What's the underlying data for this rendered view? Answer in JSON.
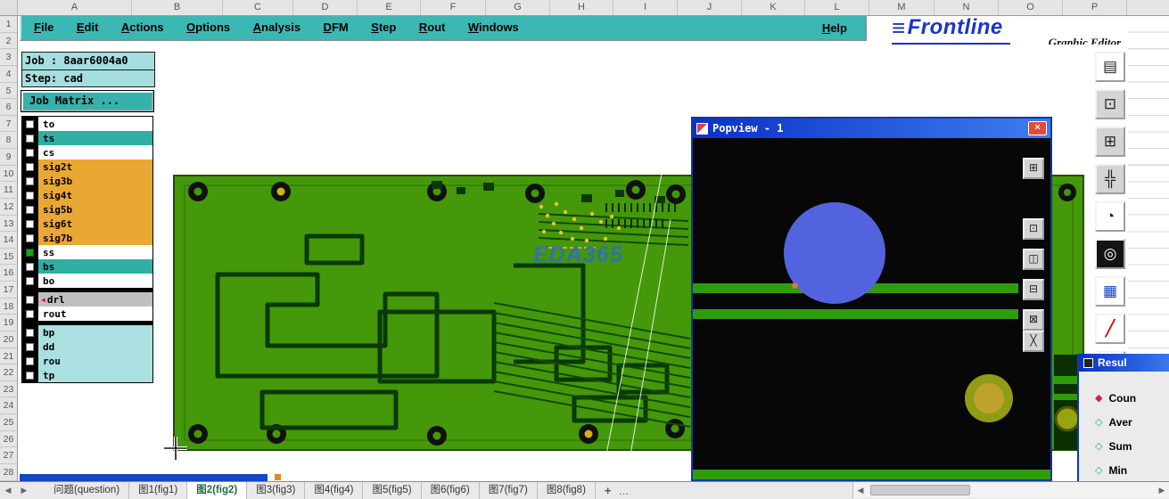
{
  "excel": {
    "columns": [
      {
        "label": "A",
        "css": "width:128px"
      },
      {
        "label": "B",
        "css": "width:102px"
      },
      {
        "label": "C",
        "css": "width:79px"
      },
      {
        "label": "D",
        "css": "width:72px"
      },
      {
        "label": "E",
        "css": "width:71px"
      },
      {
        "label": "F",
        "css": "width:73px"
      },
      {
        "label": "G",
        "css": "width:72px"
      },
      {
        "label": "H",
        "css": "width:71px"
      },
      {
        "label": "I",
        "css": "width:72px"
      },
      {
        "label": "J",
        "css": "width:72px"
      },
      {
        "label": "K",
        "css": "width:71px"
      },
      {
        "label": "L",
        "css": "width:72px"
      },
      {
        "label": "M",
        "css": "width:73px"
      },
      {
        "label": "N",
        "css": "width:72px"
      },
      {
        "label": "O",
        "css": "width:72px"
      },
      {
        "label": "P",
        "css": "width:72px"
      }
    ],
    "rows": [
      "1",
      "2",
      "3",
      "4",
      "5",
      "6",
      "7",
      "8",
      "9",
      "10",
      "11",
      "12",
      "13",
      "14",
      "15",
      "16",
      "17",
      "18",
      "19",
      "20",
      "21",
      "22",
      "23",
      "24",
      "25",
      "26",
      "27",
      "28"
    ],
    "nav_prev": "◀",
    "nav_next": "▶",
    "sheet_tabs": [
      {
        "label": "问题(question)",
        "css": ""
      },
      {
        "label": "图1(fig1)",
        "css": ""
      },
      {
        "label": "图2(fig2)",
        "css": "background:#ffffff;color:#1e6e41;font-weight:bold"
      },
      {
        "label": "图3(fig3)",
        "css": ""
      },
      {
        "label": "图4(fig4)",
        "css": ""
      },
      {
        "label": "图5(fig5)",
        "css": ""
      },
      {
        "label": "图6(fig6)",
        "css": ""
      },
      {
        "label": "图7(fig7)",
        "css": ""
      },
      {
        "label": "图8(fig8)",
        "css": ""
      }
    ],
    "add_sheet": "+",
    "tab_overflow": "…",
    "scroll_left": "◀",
    "scroll_right": "▶"
  },
  "app": {
    "menu": [
      "File",
      "Edit",
      "Actions",
      "Options",
      "Analysis",
      "DFM",
      "Step",
      "Rout",
      "Windows"
    ],
    "help": "Help",
    "logo": {
      "mark": "≡",
      "brand": "Frontline",
      "subtitle": "Graphic Editor"
    },
    "job_label": "Job : 8aar6004a0",
    "step_label": "Step: cad",
    "matrix_button": "Job Matrix ...",
    "watermark": "EDA365",
    "layers_top": [
      {
        "name": "to",
        "css": "background:#ffffff"
      },
      {
        "name": "ts",
        "css": "background:#2faea4"
      },
      {
        "name": "cs",
        "css": "background:#ffffff"
      },
      {
        "name": "sig2t",
        "css": "background:#e9a733"
      },
      {
        "name": "sig3b",
        "css": "background:#e9a733"
      },
      {
        "name": "sig4t",
        "css": "background:#e9a733"
      },
      {
        "name": "sig5b",
        "css": "background:#e9a733"
      },
      {
        "name": "sig6t",
        "css": "background:#e9a733"
      },
      {
        "name": "sig7b",
        "css": "background:#e9a733"
      },
      {
        "name": "ss",
        "css": "background:#ffffff",
        "box_css": "background:#1ca01c;border-color:#0a600a"
      },
      {
        "name": "bs",
        "css": "background:#2faea4"
      },
      {
        "name": "bo",
        "css": "background:#ffffff"
      }
    ],
    "layers_mid": [
      {
        "name": "drl",
        "css": "background:#bfbfbf",
        "mark": "◀",
        "mark_css": "color:#d42020"
      },
      {
        "name": "rout",
        "css": "background:#ffffff"
      }
    ],
    "layers_bot": [
      {
        "name": "bp",
        "css": "background:#abe0e0"
      },
      {
        "name": "dd",
        "css": "background:#abe0e0"
      },
      {
        "name": "rou",
        "css": "background:#abe0e0"
      },
      {
        "name": "tp",
        "css": "background:#abe0e0"
      }
    ],
    "toolbar": [
      {
        "name": "tool-page-button",
        "glyph": "▤",
        "css": "background:#ffffff"
      },
      {
        "name": "tool-export-window-button",
        "glyph": "⊡",
        "css": ""
      },
      {
        "name": "tool-tile-window-button",
        "glyph": "⊞",
        "css": ""
      },
      {
        "name": "tool-pan-crosshair-button",
        "glyph": "╬",
        "css": ""
      },
      {
        "name": "tool-gauge-button",
        "glyph": "◔",
        "css": "background:#ffffff"
      },
      {
        "name": "tool-target-button",
        "glyph": "◎",
        "css": "background:#141414;color:#ffffff"
      },
      {
        "name": "tool-palette-button",
        "glyph": "▦",
        "css": "background:#ffffff;color:#1040d0"
      },
      {
        "name": "tool-measure-line-button",
        "glyph": "╱",
        "css": "background:#ffffff;color:#d01818;font-weight:bold"
      },
      {
        "name": "tool-snippet-button",
        "glyph": "⊡",
        "css": "background:#ffffff;color:#d01818"
      }
    ],
    "popview": {
      "title": "Popview - 1",
      "close": "×",
      "tools": [
        {
          "name": "popview-capture-icon",
          "glyph": "⊞"
        },
        {
          "name": "popview-export-icon",
          "glyph": "⊡"
        },
        {
          "name": "popview-cascade-icon",
          "glyph": "◫"
        },
        {
          "name": "popview-minimize-icon",
          "glyph": "⊟"
        },
        {
          "name": "popview-maximize-icon",
          "glyph": "⊠"
        },
        {
          "name": "popview-crosshair-icon",
          "glyph": "╳"
        }
      ]
    },
    "result": {
      "title": "Resul",
      "items": [
        {
          "label": "Coun",
          "d": "◆",
          "css": "color:#d81666"
        },
        {
          "label": "Aver",
          "d": "◇",
          "css": "color:#18a8a8"
        },
        {
          "label": "Sum",
          "d": "◇",
          "css": "color:#18a8a8"
        },
        {
          "label": "Min",
          "d": "◇",
          "css": "color:#18a8a8"
        }
      ]
    }
  }
}
